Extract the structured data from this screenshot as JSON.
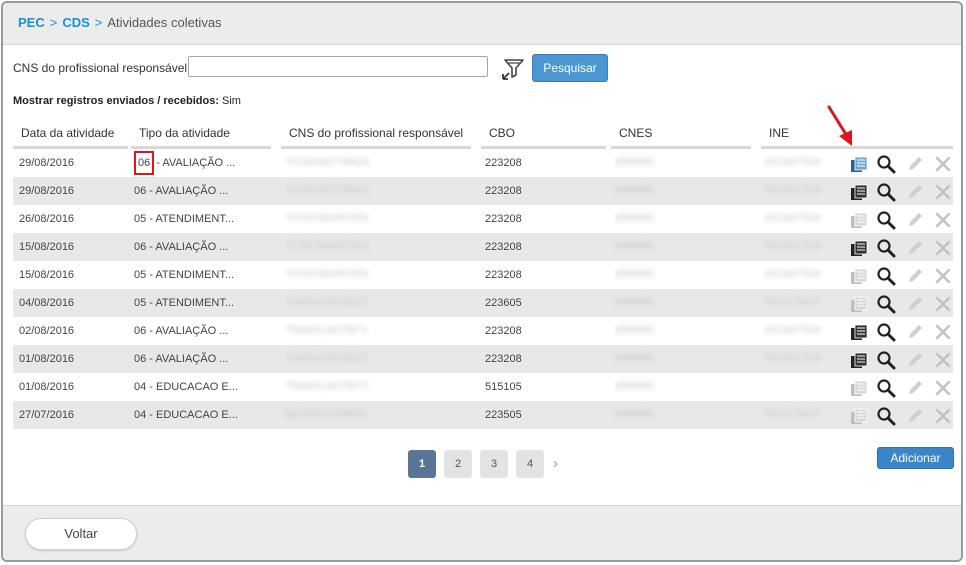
{
  "breadcrumb": {
    "item1": "PEC",
    "item2": "CDS",
    "current": "Atividades coletivas",
    "separator": ">"
  },
  "search": {
    "label": "CNS do profissional responsável",
    "value": "",
    "button": "Pesquisar"
  },
  "filter_info": {
    "label": "Mostrar registros enviados / recebidos:",
    "value": "Sim"
  },
  "table": {
    "headers": [
      "Data da atividade",
      "Tipo da atividade",
      "CNS do profissional responsável",
      "CBO",
      "CNES",
      "INE"
    ],
    "rows": [
      {
        "date": "29/08/2016",
        "type_code": "06",
        "type_rest": "- AVALIAÇÃO ...",
        "cns": "702304497708633",
        "cbo": "223208",
        "cnes": "9999995",
        "ine": "0015947526",
        "sent": false
      },
      {
        "date": "29/08/2016",
        "type": "06 - AVALIAÇÃO ...",
        "cns": "702304497708633",
        "cbo": "223208",
        "cnes": "9999995",
        "ine": "0015947526",
        "sent": true
      },
      {
        "date": "26/08/2016",
        "type": "05 - ATENDIMENT...",
        "cns": "707007804097065",
        "cbo": "223208",
        "cnes": "9999995",
        "ine": "0015947526",
        "sent": false
      },
      {
        "date": "15/08/2016",
        "type": "06 - AVALIAÇÃO ...",
        "cns": "707007804097065",
        "cbo": "223208",
        "cnes": "9999995",
        "ine": "0015947526",
        "sent": true
      },
      {
        "date": "15/08/2016",
        "type": "05 - ATENDIMENT...",
        "cns": "707007804097065",
        "cbo": "223208",
        "cnes": "9999995",
        "ine": "0015947526",
        "sent": false
      },
      {
        "date": "04/08/2016",
        "type": "05 - ATENDIMENT...",
        "cns": "708406116075871",
        "cbo": "223605",
        "cnes": "9999995",
        "ine": "0015178637",
        "sent": false
      },
      {
        "date": "02/08/2016",
        "type": "06 - AVALIAÇÃO ...",
        "cns": "708406116075871",
        "cbo": "223208",
        "cnes": "9999995",
        "ine": "0015947526",
        "sent": true
      },
      {
        "date": "01/08/2016",
        "type": "06 - AVALIAÇÃO ...",
        "cns": "708406116075871",
        "cbo": "223208",
        "cnes": "9999995",
        "ine": "0015947526",
        "sent": true
      },
      {
        "date": "01/08/2016",
        "type": "04 - EDUCACAO E...",
        "cns": "708406116075870",
        "cbo": "515105",
        "cnes": "9999995",
        "ine": "",
        "sent": false
      },
      {
        "date": "27/07/2016",
        "type": "04 - EDUCACAO E...",
        "cns": "863306011599001",
        "cbo": "223505",
        "cnes": "9999995",
        "ine": "0015178637",
        "sent": false
      }
    ],
    "actions": {
      "send": "transmit-icon",
      "view": "search-icon",
      "edit": "pencil-icon",
      "delete": "close-icon"
    }
  },
  "pagination": {
    "pages": [
      "1",
      "2",
      "3",
      "4"
    ],
    "current": "1",
    "next": "›"
  },
  "add_button": "Adicionar",
  "back_button": "Voltar",
  "colors": {
    "accent": "#1a8fd6",
    "button": "#4a97d2",
    "highlight": "#e0141e",
    "pager_active": "#5b7596"
  }
}
